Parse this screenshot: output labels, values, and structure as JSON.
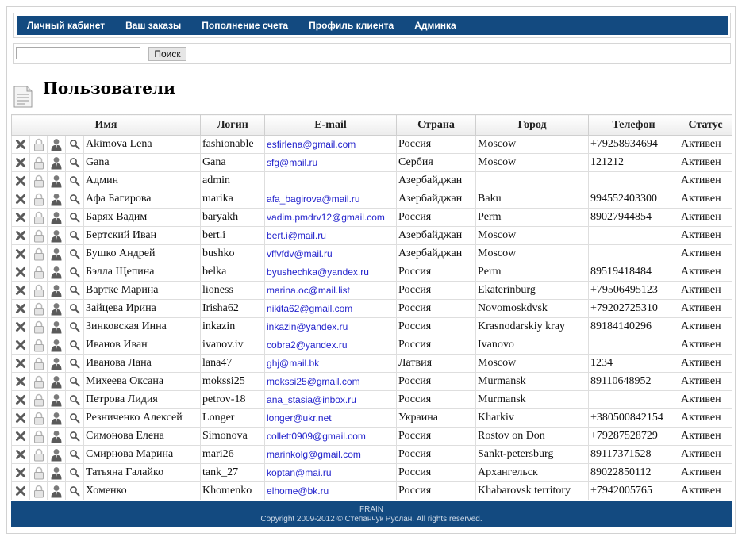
{
  "nav": {
    "items": [
      "Личный кабинет",
      "Ваш заказы",
      "Пополнение счета",
      "Профиль клиента",
      "Админка"
    ]
  },
  "search": {
    "value": "",
    "button_label": "Поиск"
  },
  "page": {
    "title": "Пользователи"
  },
  "table": {
    "headers": {
      "name": "Имя",
      "login": "Логин",
      "email": "E-mail",
      "country": "Страна",
      "city": "Город",
      "phone": "Телефон",
      "status": "Статус"
    },
    "rows": [
      {
        "name": "Akimova Lena",
        "login": "fashionable",
        "email": "esfirlena@gmail.com",
        "country": "Россия",
        "city": "Moscow",
        "phone": "+79258934694",
        "status": "Активен"
      },
      {
        "name": "Gana",
        "login": "Gana",
        "email": "sfg@mail.ru",
        "country": "Сербия",
        "city": "Moscow",
        "phone": "121212",
        "status": "Активен"
      },
      {
        "name": "Админ",
        "login": "admin",
        "email": "",
        "country": "Азербайджан",
        "city": "",
        "phone": "",
        "status": "Активен"
      },
      {
        "name": "Афа Багирова",
        "login": "marika",
        "email": "afa_bagirova@mail.ru",
        "country": "Азербайджан",
        "city": "Baku",
        "phone": "994552403300",
        "status": "Активен"
      },
      {
        "name": "Барях Вадим",
        "login": "baryakh",
        "email": "vadim.pmdrv12@gmail.com",
        "country": "Россия",
        "city": "Perm",
        "phone": "89027944854",
        "status": "Активен"
      },
      {
        "name": "Бертский Иван",
        "login": "bert.i",
        "email": "bert.i@mail.ru",
        "country": "Азербайджан",
        "city": "Moscow",
        "phone": "",
        "status": "Активен"
      },
      {
        "name": "Бушко Андрей",
        "login": "bushko",
        "email": "vffvfdv@mail.ru",
        "country": "Азербайджан",
        "city": "Moscow",
        "phone": "",
        "status": "Активен"
      },
      {
        "name": "Бэлла Щепина",
        "login": "belka",
        "email": "byushechka@yandex.ru",
        "country": "Россия",
        "city": "Perm",
        "phone": "89519418484",
        "status": "Активен"
      },
      {
        "name": "Вартке Марина",
        "login": "lioness",
        "email": "marina.oc@mail.list",
        "country": "Россия",
        "city": "Ekaterinburg",
        "phone": "+79506495123",
        "status": "Активен"
      },
      {
        "name": "Зайцева Ирина",
        "login": "Irisha62",
        "email": "nikita62@gmail.com",
        "country": "Россия",
        "city": "Novomoskdvsk",
        "phone": "+79202725310",
        "status": "Активен"
      },
      {
        "name": "Зинковская Инна",
        "login": "inkazin",
        "email": "inkazin@yandex.ru",
        "country": "Россия",
        "city": "Krasnodarskiy kray",
        "phone": "89184140296",
        "status": "Активен"
      },
      {
        "name": "Иванов Иван",
        "login": "ivanov.iv",
        "email": "cobra2@yandex.ru",
        "country": "Россия",
        "city": "Ivanovo",
        "phone": "",
        "status": "Активен"
      },
      {
        "name": "Иванова Лана",
        "login": "lana47",
        "email": "ghj@mail.bk",
        "country": "Латвия",
        "city": "Moscow",
        "phone": "1234",
        "status": "Активен"
      },
      {
        "name": "Михеева Оксана",
        "login": "mokssi25",
        "email": "mokssi25@gmail.com",
        "country": "Россия",
        "city": "Murmansk",
        "phone": "89110648952",
        "status": "Активен"
      },
      {
        "name": "Петрова Лидия",
        "login": "petrov-18",
        "email": "ana_stasia@inbox.ru",
        "country": "Россия",
        "city": "Murmansk",
        "phone": "",
        "status": "Активен"
      },
      {
        "name": "Резниченко Алексей",
        "login": "Longer",
        "email": "longer@ukr.net",
        "country": "Украина",
        "city": "Kharkiv",
        "phone": "+380500842154",
        "status": "Активен"
      },
      {
        "name": "Симонова Елена",
        "login": "Simonova",
        "email": "collett0909@gmail.com",
        "country": "Россия",
        "city": "Rostov on Don",
        "phone": "+79287528729",
        "status": "Активен"
      },
      {
        "name": "Смирнова Марина",
        "login": "mari26",
        "email": "marinkolg@gmail.com",
        "country": "Россия",
        "city": "Sankt-petersburg",
        "phone": "89117371528",
        "status": "Активен"
      },
      {
        "name": "Татьяна Галайко",
        "login": "tank_27",
        "email": "koptan@mai.ru",
        "country": "Россия",
        "city": "Архангельск",
        "phone": "89022850112",
        "status": "Активен"
      },
      {
        "name": "Хоменко",
        "login": "Khomenko",
        "email": "elhome@bk.ru",
        "country": "Россия",
        "city": "Khabarovsk territory",
        "phone": "+7942005765",
        "status": "Активен"
      }
    ]
  },
  "footer": {
    "line1": "FRAIN",
    "line2": "Copyright 2009-2012 © Степанчук Руслан. All rights reserved."
  },
  "icons": {
    "row_actions": [
      "delete-icon",
      "lock-icon",
      "user-icon",
      "search-icon"
    ],
    "title": "document-icon"
  },
  "colors": {
    "nav_bg": "#134a80",
    "email_link": "#2222cc"
  }
}
